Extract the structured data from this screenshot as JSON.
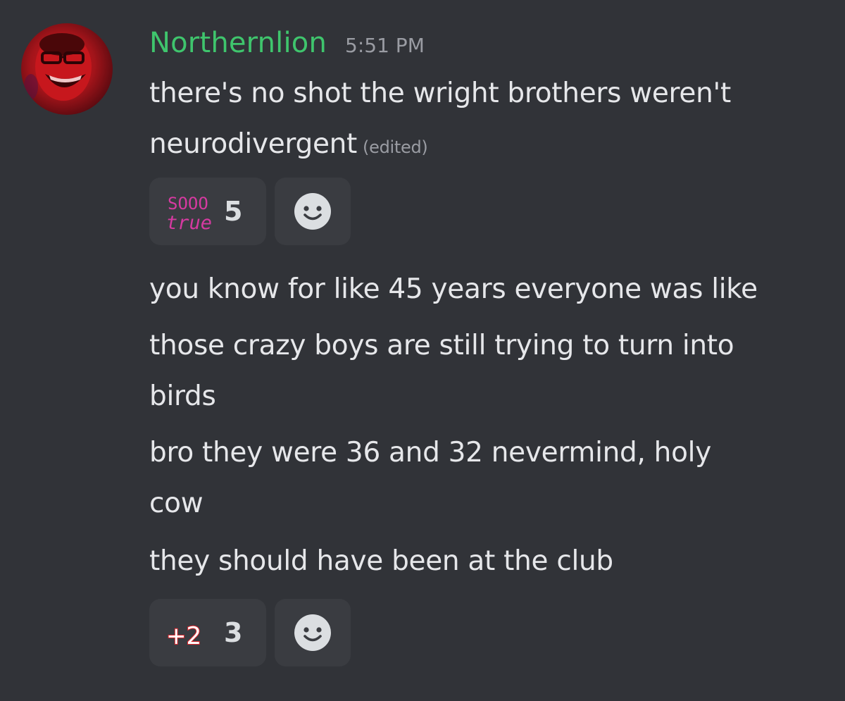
{
  "message": {
    "author": "Northernlion",
    "timestamp": "5:51 PM",
    "edited_label": "(edited)",
    "username_color": "#3fc56d",
    "lines": [
      "there's no shot the wright brothers weren't",
      "neurodivergent",
      "you know for like 45 years everyone was like",
      "those crazy boys are still trying to turn into",
      "birds",
      "bro they were 36 and 32 nevermind, holy",
      "cow",
      "they should have been at the club"
    ]
  },
  "reactions": [
    {
      "emoji_name": "sooo-true-emoji",
      "emoji_text_top": "SOOO",
      "emoji_text_bottom": "true",
      "emoji_color": "#d63aa1",
      "count": "5"
    },
    {
      "emoji_name": "plus-two-emoji",
      "emoji_text": "+2",
      "emoji_color": "#e0272d",
      "count": "3"
    }
  ],
  "add_reaction_icon": "smile-icon"
}
